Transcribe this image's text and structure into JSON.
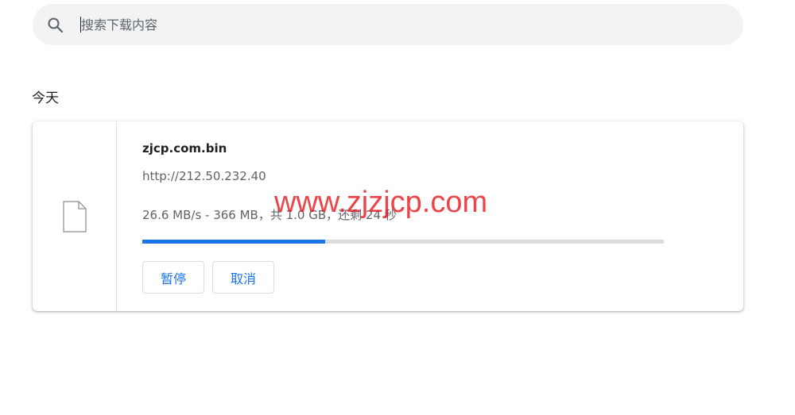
{
  "search": {
    "placeholder": "搜索下载内容",
    "value": ""
  },
  "section": {
    "title": "今天"
  },
  "download": {
    "file_name": "zjcp.com.bin",
    "url": "http://212.50.232.40",
    "status": "26.6 MB/s - 366 MB，共 1.0 GB，还剩 24 秒",
    "progress_percent": 35,
    "pause_label": "暂停",
    "cancel_label": "取消"
  },
  "watermark": {
    "text": "www.zjzjcp.com"
  },
  "colors": {
    "accent": "#1a73e8",
    "track": "#dadce0",
    "search_bg": "#f1f3f4",
    "watermark": "#e8161c"
  }
}
